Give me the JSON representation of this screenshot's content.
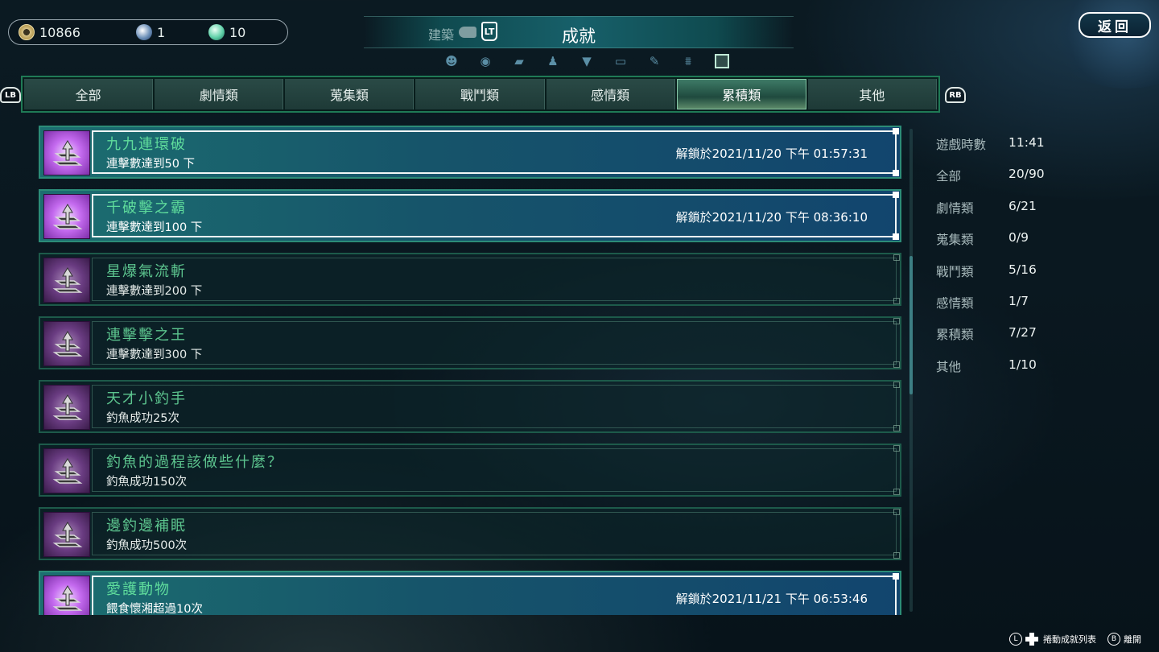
{
  "currency": {
    "coins": "10866",
    "orbs": "1",
    "jade": "10"
  },
  "header": {
    "prev_section": "建築",
    "prev_button": "LT",
    "title": "成就",
    "back_label": "返回"
  },
  "top_icons": [
    "mask-icon",
    "swirl-icon",
    "book-icon",
    "figure-icon",
    "shirt-icon",
    "chest-icon",
    "brush-icon",
    "gate-icon",
    "scroll-icon"
  ],
  "bumpers": {
    "left": "LB",
    "right": "RB"
  },
  "tabs": [
    {
      "label": "全部"
    },
    {
      "label": "劇情類"
    },
    {
      "label": "蒐集類"
    },
    {
      "label": "戰鬥類"
    },
    {
      "label": "感情類"
    },
    {
      "label": "累積類",
      "active": true
    },
    {
      "label": "其他"
    }
  ],
  "achievements": [
    {
      "title": "九九連環破",
      "desc": "連擊數達到50 下",
      "date": "解鎖於2021/11/20 下午 01:57:31",
      "unlocked": true
    },
    {
      "title": "千破擊之霸",
      "desc": "連擊數達到100 下",
      "date": "解鎖於2021/11/20 下午 08:36:10",
      "unlocked": true
    },
    {
      "title": "星爆氣流斬",
      "desc": "連擊數達到200 下",
      "date": "",
      "unlocked": false
    },
    {
      "title": "連擊擊之王",
      "desc": "連擊數達到300 下",
      "date": "",
      "unlocked": false
    },
    {
      "title": "天才小釣手",
      "desc": "釣魚成功25次",
      "date": "",
      "unlocked": false
    },
    {
      "title": "釣魚的過程該做些什麼？",
      "desc": "釣魚成功150次",
      "date": "",
      "unlocked": false
    },
    {
      "title": "邊釣邊補眠",
      "desc": "釣魚成功500次",
      "date": "",
      "unlocked": false
    },
    {
      "title": "愛護動物",
      "desc": "餵食懷湘超過10次",
      "date": "解鎖於2021/11/21 下午 06:53:46",
      "unlocked": true
    }
  ],
  "stats": [
    {
      "label": "遊戲時數",
      "value": "11:41"
    },
    {
      "label": "全部",
      "value": "20/90"
    },
    {
      "label": "劇情類",
      "value": "6/21"
    },
    {
      "label": "蒐集類",
      "value": "0/9"
    },
    {
      "label": "戰鬥類",
      "value": "5/16"
    },
    {
      "label": "感情類",
      "value": "1/7"
    },
    {
      "label": "累積類",
      "value": "7/27"
    },
    {
      "label": "其他",
      "value": "1/10"
    }
  ],
  "footer": {
    "scroll_hint": "捲動成就列表",
    "scroll_key": "L",
    "leave_hint": "離開",
    "leave_key": "B"
  }
}
